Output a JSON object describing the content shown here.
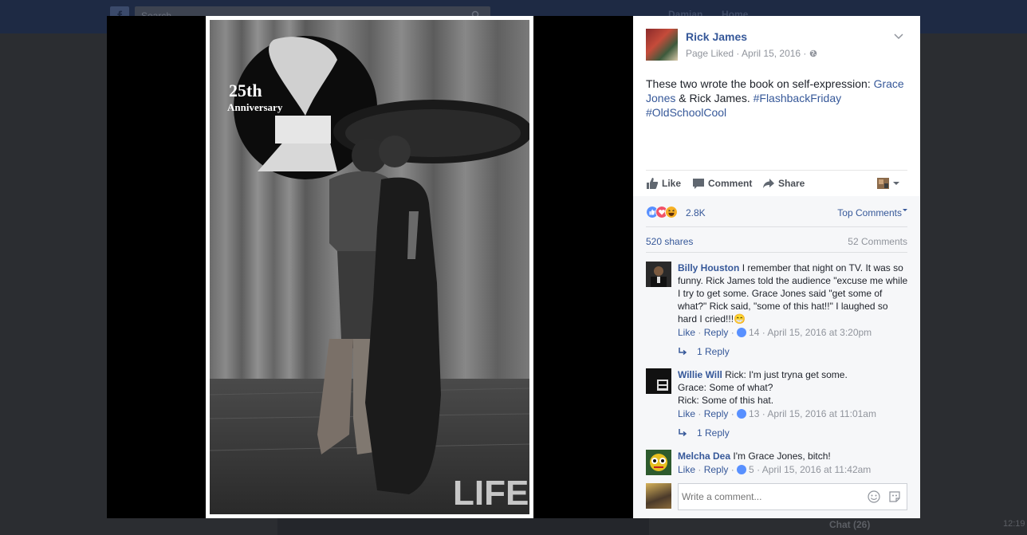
{
  "background": {
    "search_placeholder": "Search",
    "nav_name": "Damian",
    "nav_home": "Home",
    "chat_label": "Chat (26)",
    "clock": "12:19"
  },
  "photo": {
    "anniversary_number": "25th",
    "anniversary_word": "Anniversary",
    "watermark": "LIFE"
  },
  "post": {
    "page_name": "Rick James",
    "meta": "Page Liked · April 15, 2016 · ",
    "text_before": "These two wrote the book on self-expression: ",
    "mention": "Grace Jones",
    "text_middle": " & Rick James. ",
    "hashtag1": "#FlashbackFriday",
    "hashtag2": "#OldSchoolCool"
  },
  "actions": {
    "like": "Like",
    "comment": "Comment",
    "share": "Share"
  },
  "stats": {
    "reactions": "2.8K",
    "top_comments": "Top Comments",
    "shares": "520 shares",
    "comments": "52 Comments"
  },
  "comments": [
    {
      "name": "Billy Houston",
      "text": "I remember that night on TV. It was so funny. Rick James told the audience \"excuse me while I try to get some. Grace Jones said \"get some of what?\" Rick said, \"some of this hat!!\" I laughed so hard I cried!!!",
      "emoji": "😁",
      "like": "Like",
      "reply": "Reply",
      "likes": "14",
      "time": "April 15, 2016 at 3:20pm",
      "replies": "1 Reply"
    },
    {
      "name": "Willie Will",
      "line1": "Rick: I'm just tryna get some.",
      "line2": "Grace: Some of what?",
      "line3": "Rick: Some of this hat.",
      "like": "Like",
      "reply": "Reply",
      "likes": "13",
      "time": "April 15, 2016 at 11:01am",
      "replies": "1 Reply"
    },
    {
      "name": "Melcha Dea",
      "text": "I'm Grace Jones, bitch!",
      "like": "Like",
      "reply": "Reply",
      "likes": "5",
      "time": "April 15, 2016 at 11:42am"
    }
  ],
  "composer": {
    "placeholder": "Write a comment..."
  },
  "colors": {
    "link": "#365899",
    "muted": "#90949c",
    "topbar": "#1e2a44"
  }
}
